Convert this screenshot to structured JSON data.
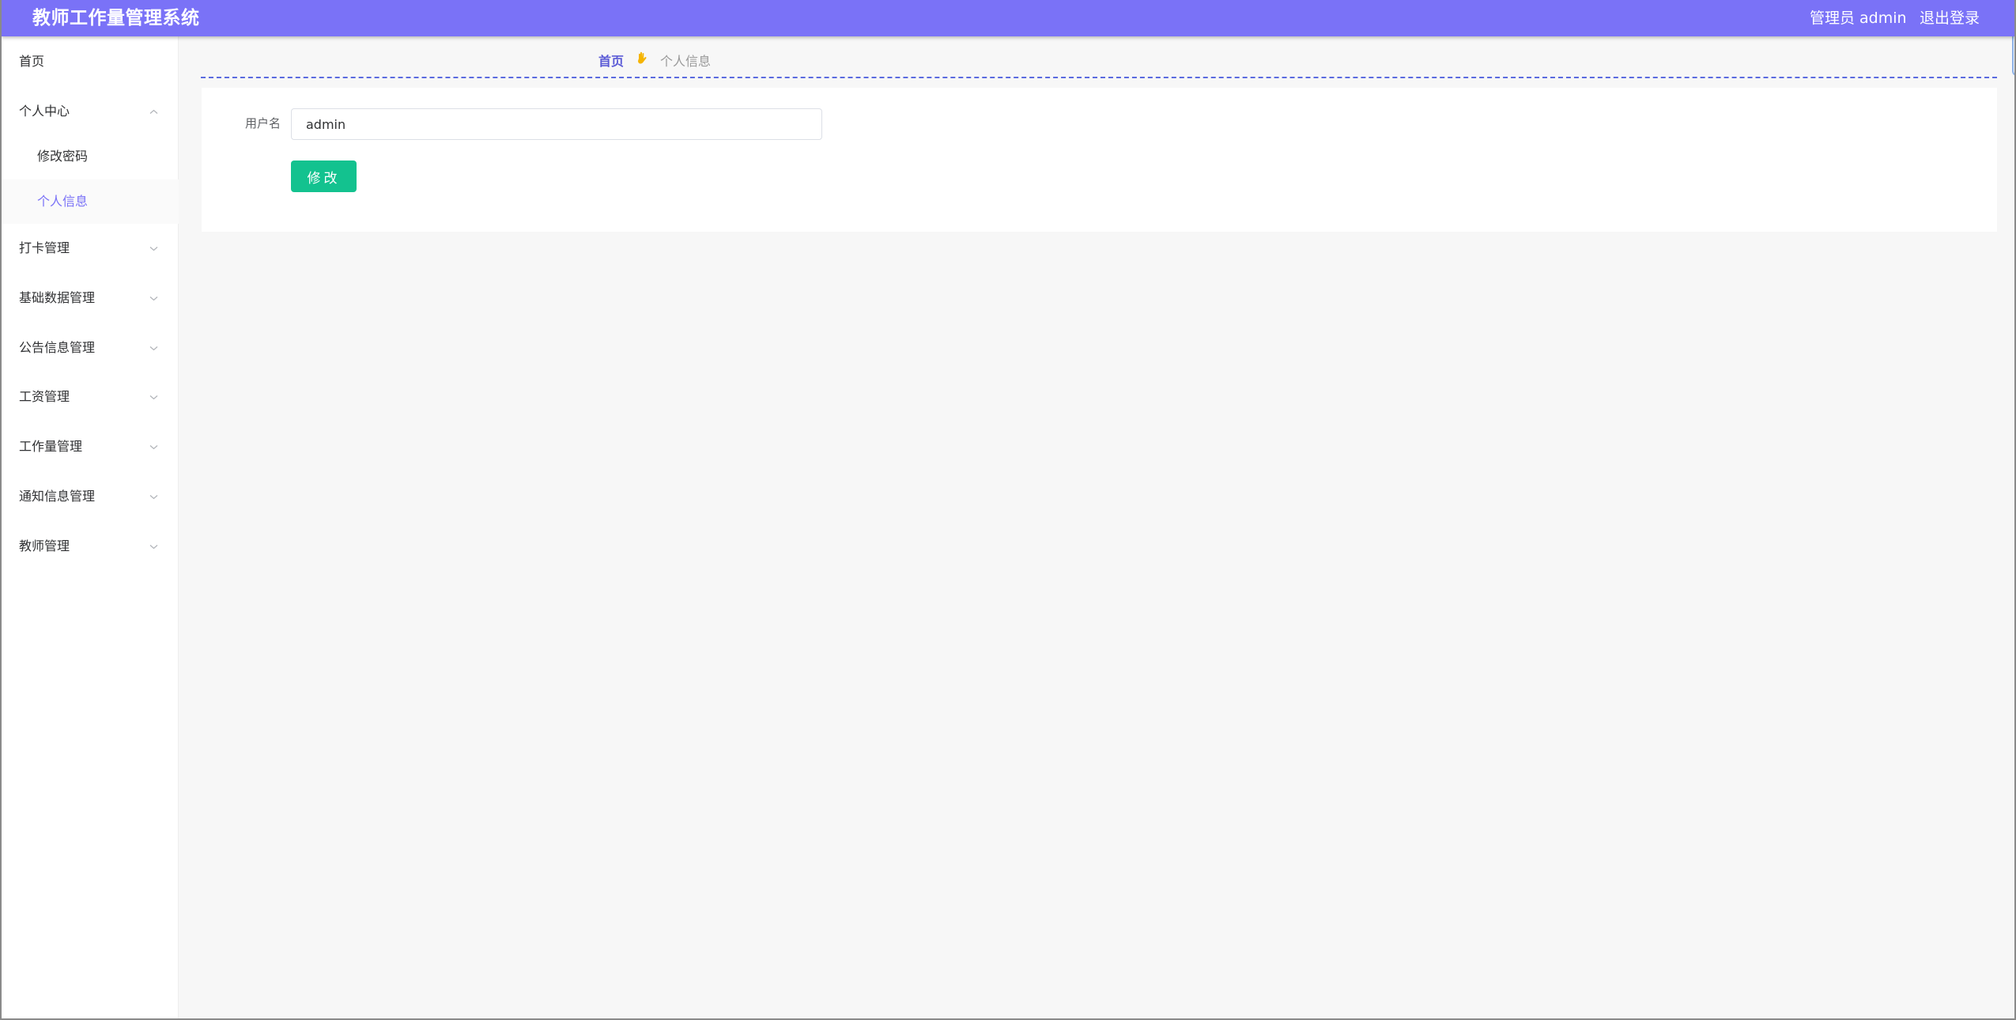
{
  "header": {
    "app_title": "教师工作量管理系统",
    "user_label": "管理员 admin",
    "logout_label": "退出登录",
    "background_color": "#7a72f7"
  },
  "sidebar": {
    "items": [
      {
        "label": "首页",
        "has_chevron": false,
        "level": 1,
        "active": false
      },
      {
        "label": "个人中心",
        "has_chevron": true,
        "level": 1,
        "active": false,
        "expanded": true
      },
      {
        "label": "修改密码",
        "has_chevron": false,
        "level": 2,
        "active": false
      },
      {
        "label": "个人信息",
        "has_chevron": false,
        "level": 2,
        "active": true
      },
      {
        "label": "打卡管理",
        "has_chevron": true,
        "level": 1,
        "active": false
      },
      {
        "label": "基础数据管理",
        "has_chevron": true,
        "level": 1,
        "active": false
      },
      {
        "label": "公告信息管理",
        "has_chevron": true,
        "level": 1,
        "active": false
      },
      {
        "label": "工资管理",
        "has_chevron": true,
        "level": 1,
        "active": false
      },
      {
        "label": "工作量管理",
        "has_chevron": true,
        "level": 1,
        "active": false
      },
      {
        "label": "通知信息管理",
        "has_chevron": true,
        "level": 1,
        "active": false
      },
      {
        "label": "教师管理",
        "has_chevron": true,
        "level": 1,
        "active": false
      }
    ]
  },
  "breadcrumb": {
    "home": "首页",
    "separator_icon": "hand-icon",
    "current": "个人信息"
  },
  "form": {
    "username_label": "用户名",
    "username_value": "admin",
    "submit_label": "修改"
  },
  "colors": {
    "accent": "#7a72f7",
    "button": "#13c28f",
    "breadcrumb_home": "#5b5bd6"
  }
}
